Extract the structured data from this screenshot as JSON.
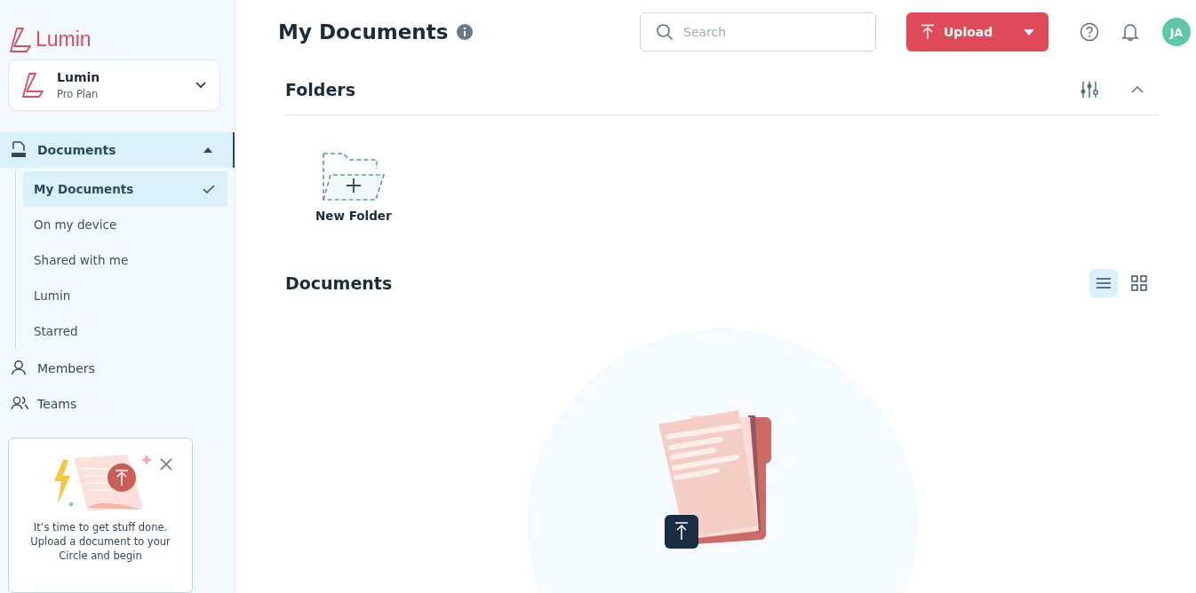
{
  "logo": {
    "text": "Lumin"
  },
  "workspace": {
    "name": "Lumin",
    "plan": "Pro Plan"
  },
  "nav": [
    {
      "label": "Documents",
      "kind": "documents",
      "selected": true,
      "expanded": true,
      "children": [
        {
          "label": "My Documents",
          "selected": true
        },
        {
          "label": "On my device",
          "selected": false
        },
        {
          "label": "Shared with me",
          "selected": false
        },
        {
          "label": "Lumin",
          "selected": false
        },
        {
          "label": "Starred",
          "selected": false
        }
      ]
    },
    {
      "label": "Members",
      "kind": "members",
      "selected": false
    },
    {
      "label": "Teams",
      "kind": "teams",
      "selected": false
    }
  ],
  "promo": {
    "text": "It’s time to get stuff done. Upload a document to your Circle and begin"
  },
  "header": {
    "title": "My Documents",
    "search": {
      "placeholder": "Search"
    },
    "upload": "Upload",
    "avatar": "JA"
  },
  "folders": {
    "title": "Folders",
    "expanded": true,
    "items": [
      {
        "label": "New Folder"
      }
    ]
  },
  "documents": {
    "title": "Documents",
    "views": [
      {
        "kind": "list",
        "selected": true
      },
      {
        "kind": "grid",
        "selected": false
      }
    ]
  }
}
